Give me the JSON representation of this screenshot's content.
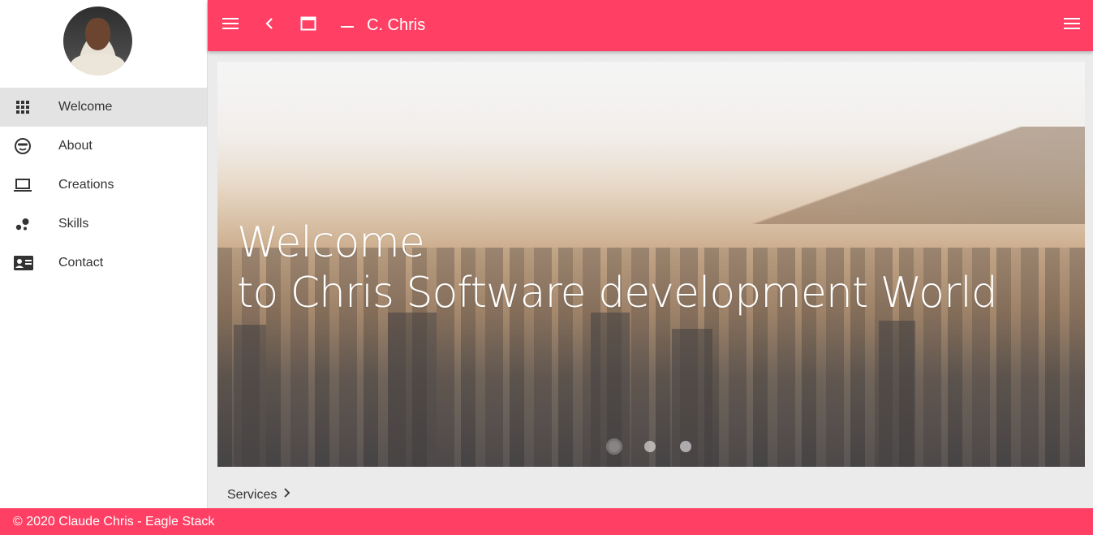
{
  "app": {
    "title": "C. Chris"
  },
  "sidebar": {
    "items": [
      {
        "label": "Welcome",
        "icon": "grid-icon",
        "active": true
      },
      {
        "label": "About",
        "icon": "cool-face-icon",
        "active": false
      },
      {
        "label": "Creations",
        "icon": "laptop-icon",
        "active": false
      },
      {
        "label": "Skills",
        "icon": "bubbles-icon",
        "active": false
      },
      {
        "label": "Contact",
        "icon": "contact-card-icon",
        "active": false
      }
    ]
  },
  "toolbar": {
    "icons": [
      "menu-icon",
      "back-chevron-icon",
      "maximize-window-icon",
      "minimize-dash-icon",
      "menu-icon"
    ]
  },
  "hero": {
    "line1": "Welcome",
    "line2": "to Chris Software development World",
    "slides_count": 3,
    "active_slide": 1
  },
  "services": {
    "label": "Services"
  },
  "footer": {
    "text": "© 2020 Claude Chris - Eagle Stack"
  },
  "colors": {
    "accent": "#ff4064",
    "sidebar_active": "#e3e3e3",
    "background": "#ebebeb"
  }
}
